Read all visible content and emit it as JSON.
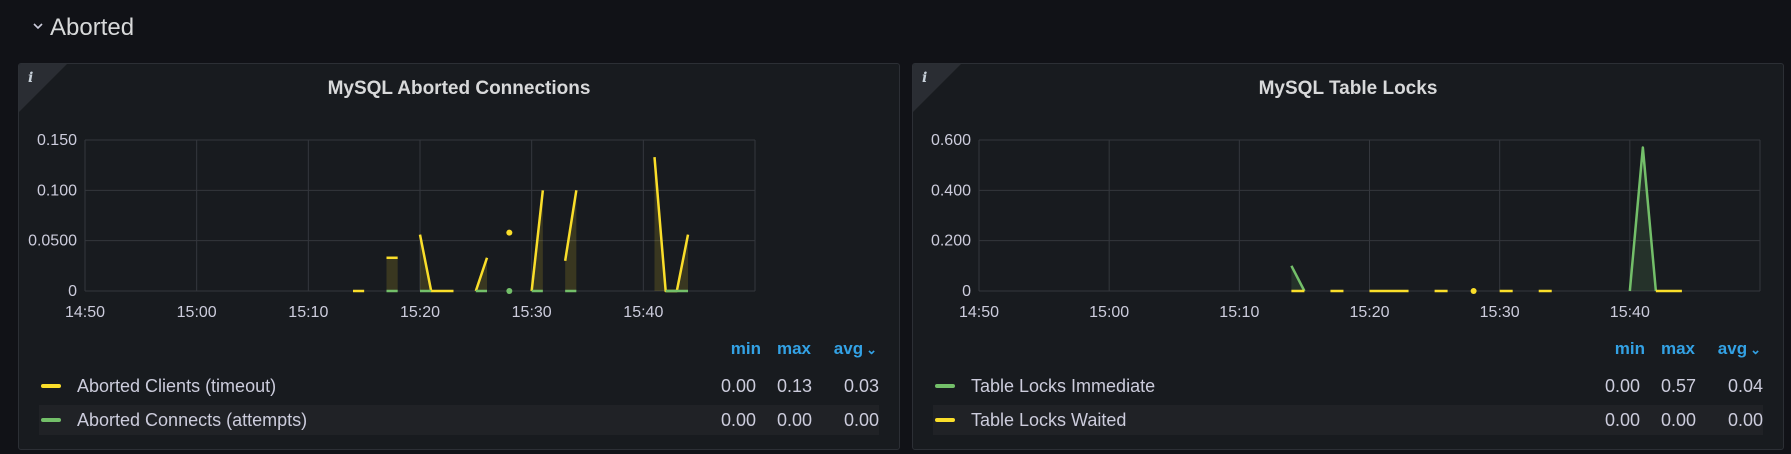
{
  "row": {
    "title": "Aborted",
    "chevron_icon": "chevron-down-icon"
  },
  "panels": [
    {
      "title": "MySQL Aborted Connections",
      "info_icon": "i",
      "legend": {
        "headers": {
          "min": "min",
          "max": "max",
          "avg": "avg",
          "sort_icon": "chevron-down-icon"
        },
        "rows": [
          {
            "name": "Aborted Clients (timeout)",
            "color": "#fade2a",
            "min": "0.00",
            "max": "0.13",
            "avg": "0.03"
          },
          {
            "name": "Aborted Connects (attempts)",
            "color": "#73bf69",
            "min": "0.00",
            "max": "0.00",
            "avg": "0.00"
          }
        ]
      }
    },
    {
      "title": "MySQL Table Locks",
      "info_icon": "i",
      "legend": {
        "headers": {
          "min": "min",
          "max": "max",
          "avg": "avg",
          "sort_icon": "chevron-down-icon"
        },
        "rows": [
          {
            "name": "Table Locks Immediate",
            "color": "#73bf69",
            "min": "0.00",
            "max": "0.57",
            "avg": "0.04"
          },
          {
            "name": "Table Locks Waited",
            "color": "#fade2a",
            "min": "0.00",
            "max": "0.00",
            "avg": "0.00"
          }
        ]
      }
    }
  ],
  "chart_data": [
    {
      "type": "area",
      "title": "MySQL Aborted Connections",
      "x_ticks": [
        "14:50",
        "15:00",
        "15:10",
        "15:20",
        "15:30",
        "15:40"
      ],
      "y_ticks": [
        "0",
        "0.0500",
        "0.100",
        "0.150"
      ],
      "xlim": [
        "14:50",
        "15:50"
      ],
      "ylim": [
        0,
        0.15
      ],
      "grid": true,
      "series": [
        {
          "name": "Aborted Clients (timeout)",
          "color": "#fade2a",
          "segments": [
            [
              [
                "15:14",
                0
              ],
              [
                "15:15",
                0
              ]
            ],
            [
              [
                "15:17",
                0.033
              ],
              [
                "15:18",
                0.033
              ]
            ],
            [
              [
                "15:20",
                0.056
              ],
              [
                "15:21",
                0
              ],
              [
                "15:23",
                0
              ]
            ],
            [
              [
                "15:25",
                0
              ],
              [
                "15:26",
                0.033
              ]
            ],
            [
              [
                "15:28",
                0.058
              ]
            ],
            [
              [
                "15:30",
                0
              ],
              [
                "15:31",
                0.1
              ]
            ],
            [
              [
                "15:33",
                0.03
              ],
              [
                "15:34",
                0.1
              ]
            ],
            [
              [
                "15:41",
                0.133
              ],
              [
                "15:42",
                0
              ],
              [
                "15:43",
                0
              ],
              [
                "15:44",
                0.056
              ]
            ]
          ]
        },
        {
          "name": "Aborted Connects (attempts)",
          "color": "#73bf69",
          "segments": [
            [
              [
                "15:17",
                0
              ],
              [
                "15:18",
                0
              ]
            ],
            [
              [
                "15:20",
                0
              ],
              [
                "15:21",
                0
              ]
            ],
            [
              [
                "15:25",
                0
              ],
              [
                "15:26",
                0
              ]
            ],
            [
              [
                "15:28",
                0
              ]
            ],
            [
              [
                "15:30",
                0
              ],
              [
                "15:31",
                0
              ]
            ],
            [
              [
                "15:33",
                0
              ],
              [
                "15:34",
                0
              ]
            ],
            [
              [
                "15:42",
                0
              ],
              [
                "15:44",
                0
              ]
            ]
          ]
        }
      ]
    },
    {
      "type": "area",
      "title": "MySQL Table Locks",
      "x_ticks": [
        "14:50",
        "15:00",
        "15:10",
        "15:20",
        "15:30",
        "15:40"
      ],
      "y_ticks": [
        "0",
        "0.200",
        "0.400",
        "0.600"
      ],
      "xlim": [
        "14:50",
        "15:50"
      ],
      "ylim": [
        0,
        0.6
      ],
      "grid": true,
      "series": [
        {
          "name": "Table Locks Immediate",
          "color": "#73bf69",
          "segments": [
            [
              [
                "15:14",
                0.1
              ],
              [
                "15:15",
                0
              ]
            ],
            [
              [
                "15:40",
                0
              ],
              [
                "15:41",
                0.57
              ],
              [
                "15:42",
                0
              ]
            ]
          ]
        },
        {
          "name": "Table Locks Waited",
          "color": "#fade2a",
          "segments": [
            [
              [
                "15:14",
                0
              ],
              [
                "15:15",
                0
              ]
            ],
            [
              [
                "15:17",
                0
              ],
              [
                "15:18",
                0
              ]
            ],
            [
              [
                "15:20",
                0
              ],
              [
                "15:23",
                0
              ]
            ],
            [
              [
                "15:25",
                0
              ],
              [
                "15:26",
                0
              ]
            ],
            [
              [
                "15:28",
                0
              ]
            ],
            [
              [
                "15:30",
                0
              ],
              [
                "15:31",
                0
              ]
            ],
            [
              [
                "15:33",
                0
              ],
              [
                "15:34",
                0
              ]
            ],
            [
              [
                "15:42",
                0
              ],
              [
                "15:44",
                0
              ]
            ]
          ]
        }
      ]
    }
  ]
}
